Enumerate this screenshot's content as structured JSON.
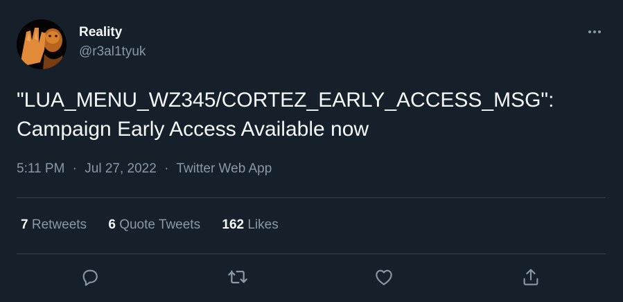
{
  "author": {
    "display_name": "Reality",
    "handle": "@r3al1tyuk"
  },
  "tweet": {
    "text": "\"LUA_MENU_WZ345/CORTEZ_EARLY_ACCESS_MSG\":\nCampaign Early Access Available now",
    "time": "5:11 PM",
    "date": "Jul 27, 2022",
    "source": "Twitter Web App",
    "separator": "·"
  },
  "stats": {
    "retweets_count": "7",
    "retweets_label": "Retweets",
    "quote_tweets_count": "6",
    "quote_tweets_label": "Quote Tweets",
    "likes_count": "162",
    "likes_label": "Likes"
  },
  "actions": {
    "icons": [
      "reply-icon",
      "retweet-icon",
      "like-icon",
      "share-icon"
    ]
  },
  "colors": {
    "background": "#15202b",
    "primary_text": "#f7f9f9",
    "secondary_text": "#8b98a5",
    "divider": "#38444d"
  }
}
